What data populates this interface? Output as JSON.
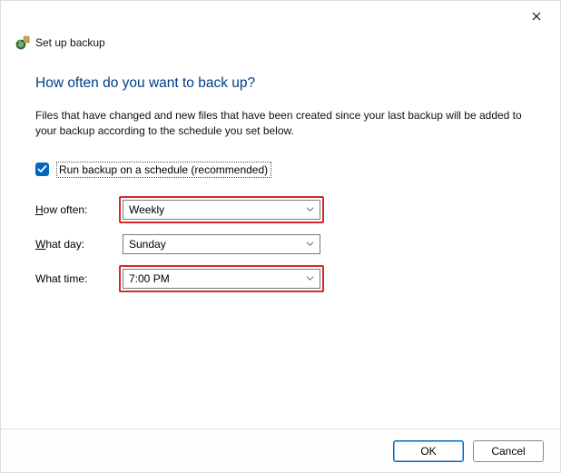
{
  "window": {
    "title": "Set up backup"
  },
  "heading": "How often do you want to back up?",
  "description": "Files that have changed and new files that have been created since your last backup will be added to your backup according to the schedule you set below.",
  "checkbox": {
    "label": "Run backup on a schedule (recommended)",
    "checked": true
  },
  "fields": {
    "how_often": {
      "label_prefix": "H",
      "label_rest": "ow often:",
      "value": "Weekly"
    },
    "what_day": {
      "label_prefix": "W",
      "label_rest": "hat day:",
      "value": "Sunday"
    },
    "what_time": {
      "label": "What time:",
      "value": "7:00 PM"
    }
  },
  "buttons": {
    "ok": "OK",
    "cancel": "Cancel"
  }
}
